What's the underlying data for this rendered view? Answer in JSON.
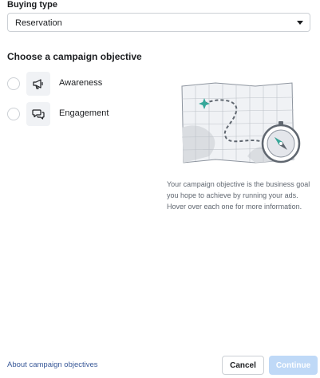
{
  "buying_type": {
    "label": "Buying type",
    "selected": "Reservation"
  },
  "objective": {
    "title": "Choose a campaign objective",
    "options": [
      {
        "label": "Awareness",
        "icon": "megaphone-icon"
      },
      {
        "label": "Engagement",
        "icon": "chat-bubbles-icon"
      }
    ],
    "description": "Your campaign objective is the business goal you hope to achieve by running your ads. Hover over each one for more information."
  },
  "footer": {
    "about_link": "About campaign objectives",
    "cancel_label": "Cancel",
    "continue_label": "Continue"
  },
  "colors": {
    "link": "#385898",
    "continue_disabled_bg": "#bfd9f7",
    "map_accent": "#36a89a"
  }
}
